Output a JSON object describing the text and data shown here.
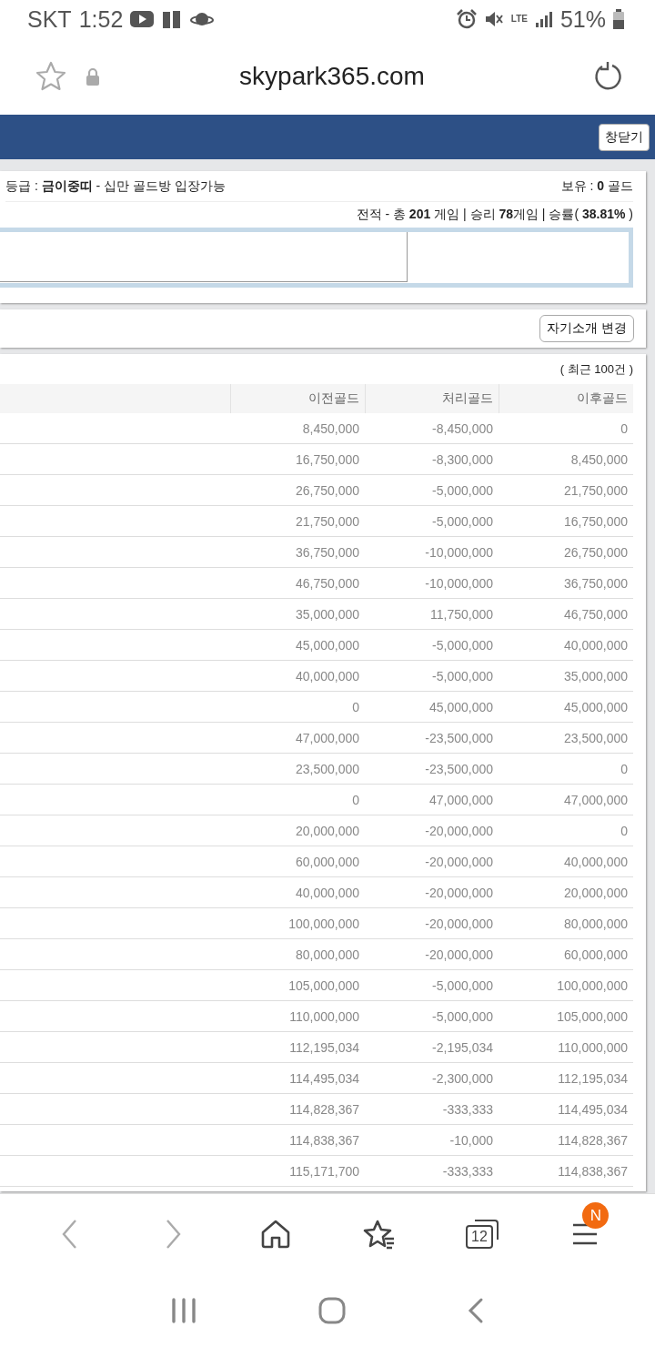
{
  "status_bar": {
    "carrier": "SKT",
    "time": "1:52",
    "network": "LTE",
    "battery": "51%"
  },
  "browser": {
    "url": "skypark365.com"
  },
  "header": {
    "close_button": "창닫기"
  },
  "profile": {
    "grade": "등급 : **금이중띠** - 십만 골드방 입장가능",
    "holding": "보유 : **0** 골드",
    "record": "전적 - 총 **201** 게임 | 승리 **78**게임 | 승률( **38.81%** )"
  },
  "intro": {
    "button": "자기소개 변경"
  },
  "history": {
    "caption": "( 최근 100건 )",
    "columns": [
      "이전골드",
      "처리골드",
      "이후골드"
    ],
    "rows": [
      [
        "8,450,000",
        "-8,450,000",
        "0"
      ],
      [
        "16,750,000",
        "-8,300,000",
        "8,450,000"
      ],
      [
        "26,750,000",
        "-5,000,000",
        "21,750,000"
      ],
      [
        "21,750,000",
        "-5,000,000",
        "16,750,000"
      ],
      [
        "36,750,000",
        "-10,000,000",
        "26,750,000"
      ],
      [
        "46,750,000",
        "-10,000,000",
        "36,750,000"
      ],
      [
        "35,000,000",
        "11,750,000",
        "46,750,000"
      ],
      [
        "45,000,000",
        "-5,000,000",
        "40,000,000"
      ],
      [
        "40,000,000",
        "-5,000,000",
        "35,000,000"
      ],
      [
        "0",
        "45,000,000",
        "45,000,000"
      ],
      [
        "47,000,000",
        "-23,500,000",
        "23,500,000"
      ],
      [
        "23,500,000",
        "-23,500,000",
        "0"
      ],
      [
        "0",
        "47,000,000",
        "47,000,000"
      ],
      [
        "20,000,000",
        "-20,000,000",
        "0"
      ],
      [
        "60,000,000",
        "-20,000,000",
        "40,000,000"
      ],
      [
        "40,000,000",
        "-20,000,000",
        "20,000,000"
      ],
      [
        "100,000,000",
        "-20,000,000",
        "80,000,000"
      ],
      [
        "80,000,000",
        "-20,000,000",
        "60,000,000"
      ],
      [
        "105,000,000",
        "-5,000,000",
        "100,000,000"
      ],
      [
        "110,000,000",
        "-5,000,000",
        "105,000,000"
      ],
      [
        "112,195,034",
        "-2,195,034",
        "110,000,000"
      ],
      [
        "114,495,034",
        "-2,300,000",
        "112,195,034"
      ],
      [
        "114,828,367",
        "-333,333",
        "114,495,034"
      ],
      [
        "114,838,367",
        "-10,000",
        "114,828,367"
      ],
      [
        "115,171,700",
        "-333,333",
        "114,838,367"
      ]
    ]
  },
  "toolbar": {
    "tab_count": "12",
    "menu_badge": "N"
  }
}
